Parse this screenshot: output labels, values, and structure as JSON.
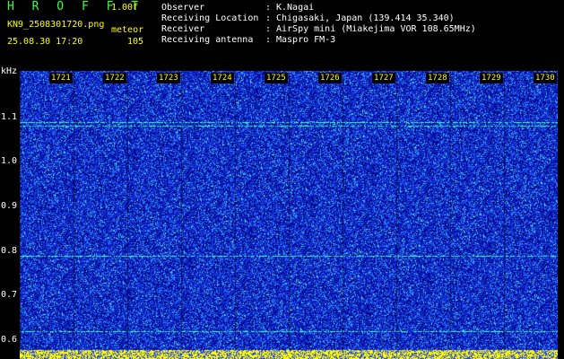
{
  "header": {
    "app_name": "H R O F F T",
    "version": "1.00f",
    "filename": "KN9_2508301720.png",
    "detection_label": "meteor",
    "datetime": "25.08.30 17:20",
    "count": "105"
  },
  "info": {
    "rows": [
      {
        "key": "Observer",
        "value": "K.Nagai"
      },
      {
        "key": "Receiving Location",
        "value": "Chigasaki, Japan (139.414 35.340)"
      },
      {
        "key": "Receiver",
        "value": "AirSpy mini (Miakejima VOR 108.65MHz)"
      },
      {
        "key": "Receiving antenna",
        "value": "Maspro FM-3"
      }
    ],
    "separator": ":"
  },
  "axis": {
    "y_unit": "kHz",
    "y_labels": [
      "1.1",
      "1.0",
      "0.9",
      "0.8",
      "0.7",
      "0.6"
    ],
    "x_labels": [
      "1721",
      "1722",
      "1723",
      "1724",
      "1725",
      "1726",
      "1727",
      "1728",
      "1729",
      "1730"
    ]
  },
  "colors": {
    "background": "#000000",
    "noise_dark": "#000080",
    "noise_mid": "#1a3cff",
    "noise_light": "#36c8ff",
    "signal": "#33ffcc",
    "label": "#ffff00",
    "logo": "#3cff3c"
  }
}
